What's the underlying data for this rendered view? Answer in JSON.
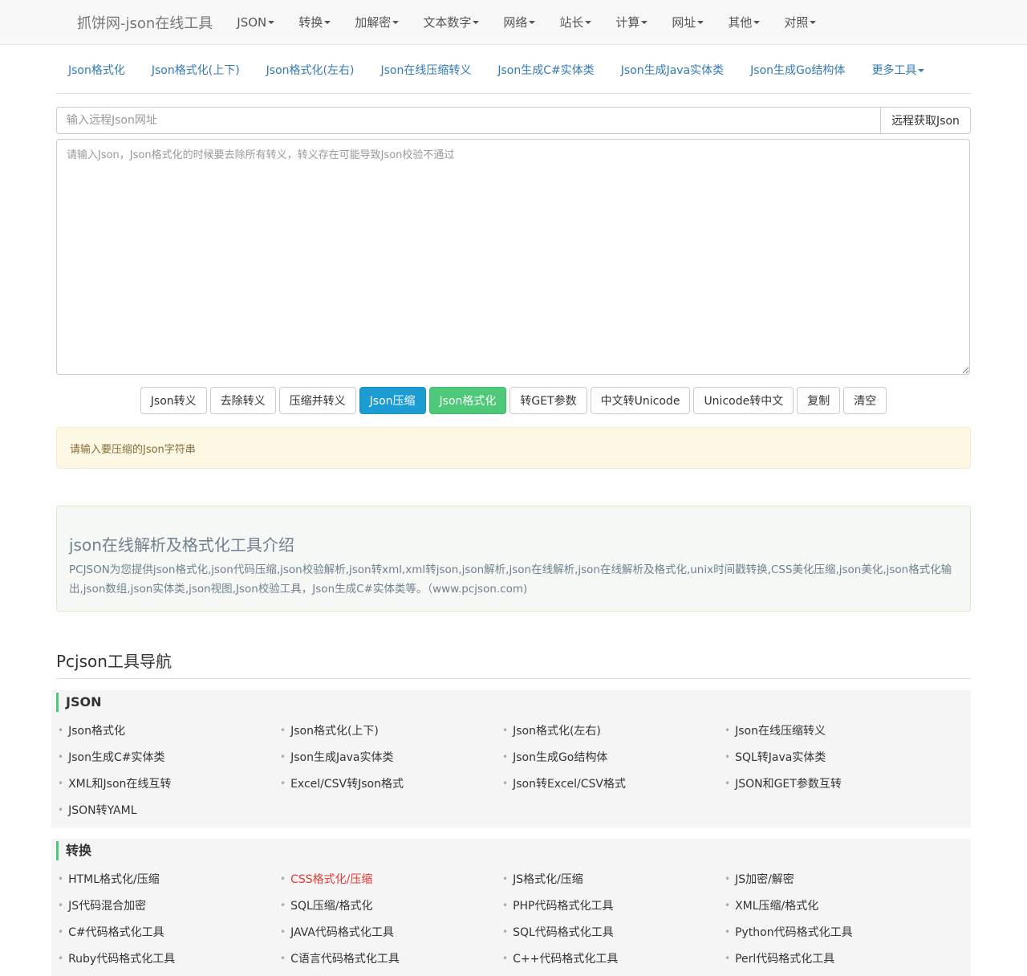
{
  "navbar": {
    "brand": "抓饼网-json在线工具",
    "items": [
      "JSON",
      "转换",
      "加解密",
      "文本数字",
      "网络",
      "站长",
      "计算",
      "网址",
      "其他",
      "对照"
    ]
  },
  "subnav": {
    "links": [
      "Json格式化",
      "Json格式化(上下)",
      "Json格式化(左右)",
      "Json在线压缩转义",
      "Json生成C#实体类",
      "Json生成Java实体类",
      "Json生成Go结构体"
    ],
    "more": "更多工具"
  },
  "url": {
    "placeholder": "输入远程Json网址",
    "button": "远程获取Json"
  },
  "editor": {
    "placeholder": "请输入Json，Json格式化的时候要去除所有转义，转义存在可能导致Json校验不通过"
  },
  "buttons": [
    "Json转义",
    "去除转义",
    "压缩并转义",
    "Json压缩",
    "Json格式化",
    "转GET参数",
    "中文转Unicode",
    "Unicode转中文",
    "复制",
    "清空"
  ],
  "alert": "请输入要压缩的Json字符串",
  "intro": {
    "title": "json在线解析及格式化工具介绍",
    "text": "PCJSON为您提供json格式化,json代码压缩,json校验解析,json转xml,xml转json,json解析,json在线解析,json在线解析及格式化,unix时间戳转换,CSS美化压缩,json美化,json格式化输出,json数组,json实体类,json视图,Json校验工具，Json生成C#实体类等。（www.pcjson.com)"
  },
  "tool_nav": {
    "title": "Pcjson工具导航",
    "sections": [
      {
        "title": "JSON",
        "items": [
          "Json格式化",
          " Json格式化(上下)",
          "Json格式化(左右)",
          "Json在线压缩转义",
          "Json生成C#实体类",
          " Json生成Java实体类",
          "Json生成Go结构体",
          "SQL转Java实体类",
          "XML和Json在线互转",
          "Excel/CSV转Json格式",
          "Json转Excel/CSV格式",
          "JSON和GET参数互转",
          "JSON转YAML"
        ]
      },
      {
        "title": "转换",
        "items": [
          "HTML格式化/压缩",
          " CSS格式化/压缩",
          "JS格式化/压缩",
          "JS加密/解密",
          " JS代码混合加密",
          "SQL压缩/格式化",
          "PHP代码格式化工具",
          "XML压缩/格式化",
          "C#代码格式化工具",
          "JAVA代码格式化工具",
          "SQL代码格式化工具",
          "Python代码格式化工具",
          "Ruby代码格式化工具",
          "C语言代码格式化工具",
          "C++代码格式化工具",
          "Perl代码格式化工具"
        ]
      }
    ]
  },
  "colors": {
    "link": "#337ab7",
    "info_button": "#1b9dd3",
    "success_button": "#4ec97a",
    "highlight_item": "#e53935"
  }
}
